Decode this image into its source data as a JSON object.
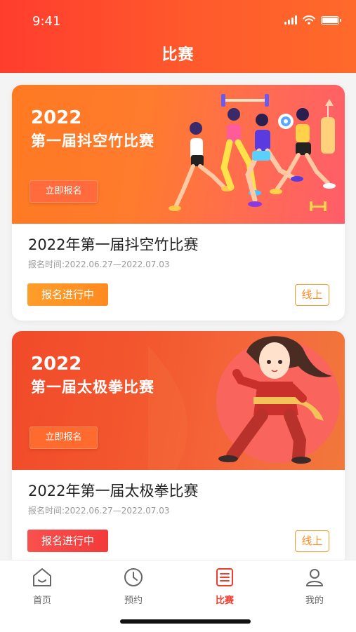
{
  "status_bar": {
    "time": "9:41"
  },
  "header": {
    "title": "比赛"
  },
  "cards": [
    {
      "banner_year": "2022",
      "banner_name": "第一届抖空竹比赛",
      "banner_button": "立即报名",
      "title": "2022年第一届抖空竹比赛",
      "date": "报名时间:2022.06.27—2022.07.03",
      "status": "报名进行中",
      "mode": "线上"
    },
    {
      "banner_year": "2022",
      "banner_name": "第一届太极拳比赛",
      "banner_button": "立即报名",
      "title": "2022年第一届太极拳比赛",
      "date": "报名时间:2022.06.27—2022.07.03",
      "status": "报名进行中",
      "mode": "线上"
    }
  ],
  "tabbar": {
    "active": "比赛",
    "items": [
      {
        "label": "首页",
        "icon": "home-icon"
      },
      {
        "label": "预约",
        "icon": "clock-icon"
      },
      {
        "label": "比赛",
        "icon": "competition-icon"
      },
      {
        "label": "我的",
        "icon": "user-icon"
      }
    ]
  },
  "colors": {
    "primary": "#f23b2c",
    "accent": "#ff8a1f"
  }
}
